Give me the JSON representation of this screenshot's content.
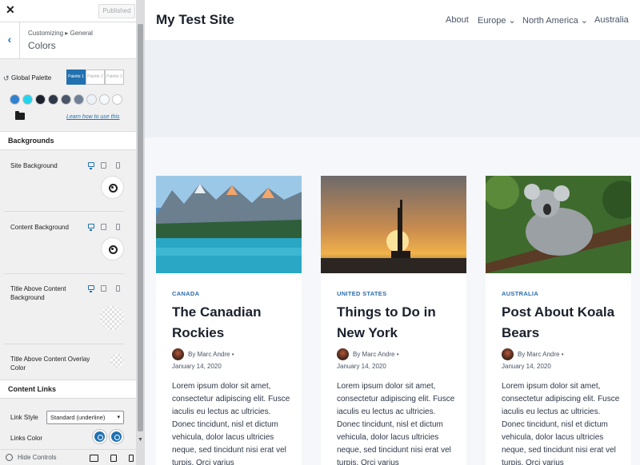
{
  "customizer": {
    "close_label": "✕",
    "publish_label": "Published",
    "back_label": "‹",
    "breadcrumb": "Customizing ▸ General",
    "section_title": "Colors",
    "global_palette": {
      "label": "Global Palette",
      "tabs": [
        "Palette 1",
        "Palette 2",
        "Palette 3"
      ],
      "active_tab": "Palette 1",
      "swatches": [
        "#3182ce",
        "#22d3ee",
        "#1a202c",
        "#2d3748",
        "#4a5568",
        "#718096",
        "#edf2f7",
        "#f7fafc",
        "#ffffff"
      ],
      "learn_link": "Learn how to use this"
    },
    "backgrounds_title": "Backgrounds",
    "site_background_label": "Site Background",
    "content_background_label": "Content Background",
    "title_above_bg_label": "Title Above Content Background",
    "title_above_overlay_label": "Title Above Content Overlay Color",
    "content_links_title": "Content Links",
    "link_style_label": "Link Style",
    "link_style_value": "Standard (underline)",
    "links_color_label": "Links Color",
    "hide_controls_label": "Hide Controls"
  },
  "site": {
    "title": "My Test Site",
    "nav": [
      {
        "label": "About"
      },
      {
        "label": "Europe ⌄"
      },
      {
        "label": "North America ⌄"
      },
      {
        "label": "Australia"
      }
    ],
    "posts": [
      {
        "category": "CANADA",
        "title": "The Canadian Rockies",
        "author": "By Marc Andre",
        "separator": "•",
        "date": "January 14, 2020",
        "excerpt": "Lorem ipsum dolor sit amet, consectetur adipiscing elit. Fusce iaculis eu lectus ac ultricies. Donec tincidunt, nisl et dictum vehicula, dolor lacus ultricies neque, sed tincidunt nisi erat vel turpis. Orci varius"
      },
      {
        "category": "UNITED STATES",
        "title": "Things to Do in New York",
        "author": "By Marc Andre",
        "separator": "•",
        "date": "January 14, 2020",
        "excerpt": "Lorem ipsum dolor sit amet, consectetur adipiscing elit. Fusce iaculis eu lectus ac ultricies. Donec tincidunt, nisl et dictum vehicula, dolor lacus ultricies neque, sed tincidunt nisi erat vel turpis. Orci varius"
      },
      {
        "category": "AUSTRALIA",
        "title": "Post About Koala Bears",
        "author": "By Marc Andre",
        "separator": "•",
        "date": "January 14, 2020",
        "excerpt": "Lorem ipsum dolor sit amet, consectetur adipiscing elit. Fusce iaculis eu lectus ac ultricies. Donec tincidunt, nisl et dictum vehicula, dolor lacus ultricies neque, sed tincidunt nisi erat vel turpis. Orci varius"
      }
    ]
  },
  "colors": {
    "accent": "#2271b1",
    "link": "#2b6cb0"
  }
}
